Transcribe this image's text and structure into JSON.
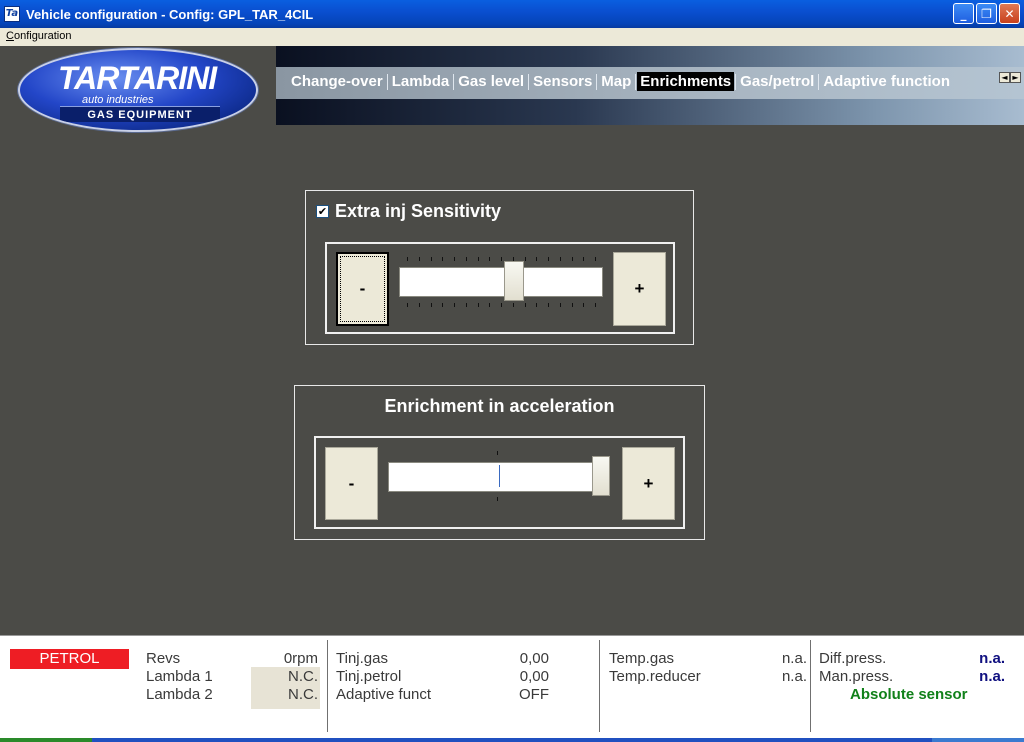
{
  "window": {
    "title": "Vehicle configuration - Config: GPL_TAR_4CIL",
    "icon": "ta-app-icon",
    "controls": {
      "minimize": "_",
      "maximize": "❐",
      "close": "✕"
    }
  },
  "menubar": {
    "items": [
      {
        "label": "Configuration",
        "accel": "C",
        "rest": "onfiguration"
      }
    ]
  },
  "logo": {
    "brand": "TARTARINI",
    "sub": "auto industries",
    "band": "GAS EQUIPMENT"
  },
  "tabs": {
    "items": [
      {
        "label": "Change-over",
        "active": false
      },
      {
        "label": "Lambda",
        "active": false
      },
      {
        "label": "Gas level",
        "active": false
      },
      {
        "label": "Sensors",
        "active": false
      },
      {
        "label": "Map",
        "active": false
      },
      {
        "label": "Enrichments",
        "active": true
      },
      {
        "label": "Gas/petrol",
        "active": false
      },
      {
        "label": "Adaptive function",
        "active": false
      }
    ],
    "scroll_left": "◄",
    "scroll_right": "►"
  },
  "extra_inj": {
    "title": "Extra inj Sensitivity",
    "checked": true,
    "check_glyph": "✔",
    "minus_label": "-",
    "plus_label": "+",
    "slider_fraction": 0.57
  },
  "enrichment": {
    "title": "Enrichment in acceleration",
    "minus_label": "-",
    "plus_label": "+",
    "slider_fraction": 1.0,
    "marker_fraction": 0.5
  },
  "status": {
    "mode": "PETROL",
    "mode_color": "#ee1d24",
    "col1": [
      {
        "label": "Revs",
        "value": "0rpm"
      },
      {
        "label": "Lambda 1",
        "value": "N.C."
      },
      {
        "label": "Lambda 2",
        "value": "N.C."
      }
    ],
    "col2": [
      {
        "label": "Tinj.gas",
        "value": "0,00"
      },
      {
        "label": "Tinj.petrol",
        "value": "0,00"
      },
      {
        "label": "Adaptive funct",
        "value": "OFF"
      }
    ],
    "col3": [
      {
        "label": "Temp.gas",
        "value": "n.a."
      },
      {
        "label": "Temp.reducer",
        "value": "n.a."
      }
    ],
    "col4": [
      {
        "label": "Diff.press.",
        "value": "n.a."
      },
      {
        "label": "Man.press.",
        "value": "n.a."
      }
    ],
    "sensor_note": "Absolute sensor"
  }
}
